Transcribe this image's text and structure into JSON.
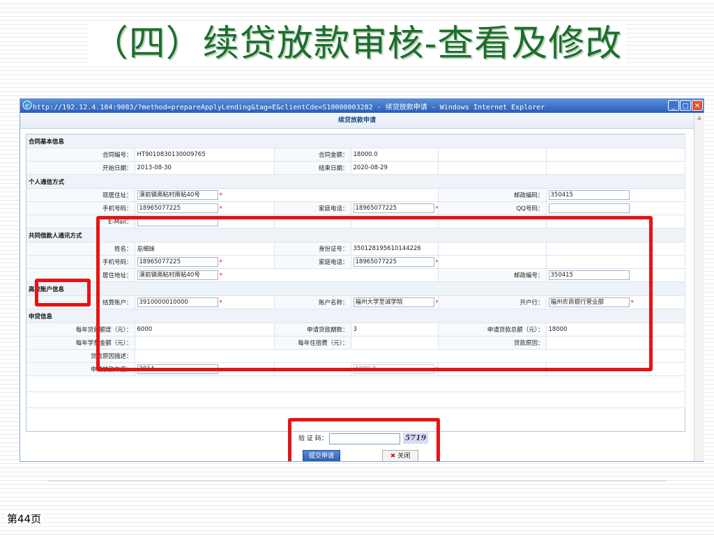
{
  "slide": {
    "title": "（四）续贷放款审核-查看及修改",
    "page_number": "第44页"
  },
  "browser": {
    "window_title": "http://192.12.4.104:9083/?method=prepareApplyLending&tag=E&clientCde=S10000003282 - 续贷放款申请 - Windows Internet Explorer",
    "min_symbol": "_",
    "max_symbol": "□",
    "close_symbol": "✕"
  },
  "page": {
    "header": "续贷放款申请"
  },
  "contract": {
    "section_title": "合同基本信息",
    "contract_no_label": "合同编号：",
    "contract_no": "HT9010830130009765",
    "amount_label": "合同金额：",
    "amount": "18000.0",
    "start_label": "开始日期：",
    "start_date": "2013-08-30",
    "end_label": "结束日期：",
    "end_date": "2020-08-29"
  },
  "personal": {
    "section_title": "个人通信方式",
    "address_label": "现居住址：",
    "address": "漠前镇南粘村南粘40号",
    "postcode_label": "邮政编码：",
    "postcode": "350415",
    "mobile_label": "手机号码：",
    "mobile": "18965077225",
    "home_phone_label": "家庭电话：",
    "home_phone": "18965077225",
    "qq_label": "QQ号码：",
    "qq": "",
    "email_label": "E-Mail：",
    "email": ""
  },
  "co_borrower": {
    "section_title": "共同借款人通讯方式",
    "name_label": "姓名：",
    "name": "巫细妹",
    "id_label": "身份证号：",
    "id_number": "350128195610144226",
    "mobile_label": "手机号码：",
    "mobile": "18965077225",
    "home_phone_label": "家庭电话：",
    "home_phone": "18965077225",
    "address_label": "居住地址：",
    "address": "漠前镇南粘村南粘40号",
    "postcode_label": "邮政编号：",
    "postcode": "350415"
  },
  "school_account": {
    "section_title": "高校账户信息",
    "account_label": "结算账户：",
    "account": "3910000010000",
    "account_name_label": "账户名称：",
    "account_name": "福州大学至诚学院",
    "bank_label": "开户行：",
    "bank": "福州农商银行营业部"
  },
  "loan": {
    "section_title": "申贷信息",
    "annual_amount_label": "每年贷款额度（元）：",
    "annual_amount": "6000",
    "periods_label": "申请贷款期数：",
    "periods": "3",
    "total_label": "申请贷款总额（元）：",
    "total": "18000",
    "tuition_label": "每年学费金额（元）：",
    "tuition": "",
    "lodging_label": "每年住宿费（元）：",
    "lodging": "",
    "reason_label": "贷款原因：",
    "reason": "",
    "reason_desc_label": "贷款原因描述：",
    "reason_desc": "",
    "year_label": "申请放款年度：",
    "year": "2014",
    "hidden_value": "6000.0"
  },
  "actions": {
    "captcha_label": "验 证 码：",
    "captcha_value": "",
    "captcha_text": "5719",
    "submit_label": "提交申请",
    "close_label": "关闭",
    "required_mark": "*"
  }
}
